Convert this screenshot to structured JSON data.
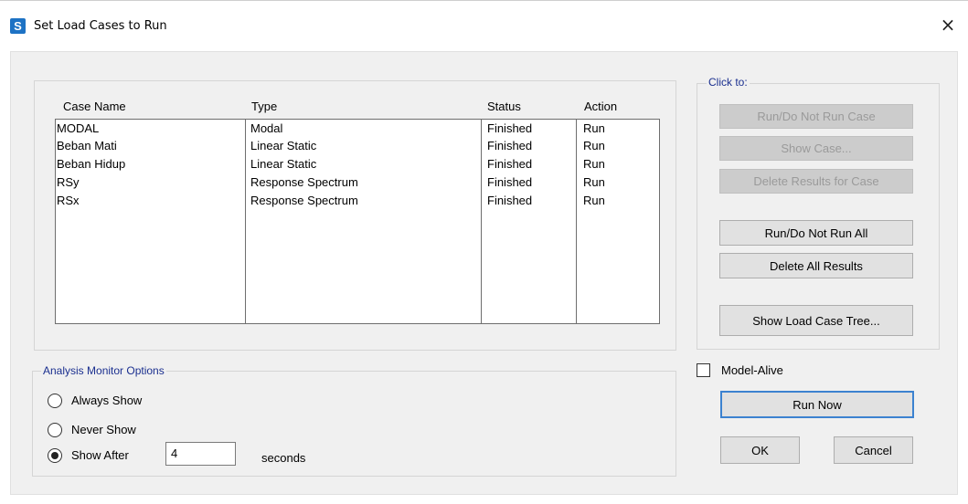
{
  "window": {
    "app_icon_letter": "S",
    "title": "Set Load Cases to Run",
    "close_glyph": "×"
  },
  "table": {
    "headers": [
      "Case Name",
      "Type",
      "Status",
      "Action"
    ],
    "rows": [
      [
        "MODAL",
        "Modal",
        "Finished",
        "Run"
      ],
      [
        "Beban Mati",
        "Linear Static",
        "Finished",
        "Run"
      ],
      [
        "Beban Hidup",
        "Linear Static",
        "Finished",
        "Run"
      ],
      [
        "RSy",
        "Response Spectrum",
        "Finished",
        "Run"
      ],
      [
        "RSx",
        "Response Spectrum",
        "Finished",
        "Run"
      ]
    ]
  },
  "click_to": {
    "title": "Click to:",
    "run_do_not_run_case": "Run/Do Not Run Case",
    "show_case": "Show Case...",
    "delete_results_for_case": "Delete Results for Case",
    "run_do_not_run_all": "Run/Do Not Run All",
    "delete_all_results": "Delete All Results",
    "show_load_case_tree": "Show Load Case Tree..."
  },
  "monitor": {
    "title": "Analysis Monitor Options",
    "always_show": "Always Show",
    "never_show": "Never Show",
    "show_after": "Show After",
    "seconds_value": "4",
    "seconds_label": "seconds",
    "selected": "show_after"
  },
  "model_alive": {
    "label": "Model-Alive",
    "checked": false
  },
  "actions": {
    "run_now": "Run Now",
    "ok": "OK",
    "cancel": "Cancel"
  },
  "colors": {
    "group_title": "#1a2f8f",
    "default_button_border": "#3c82d0",
    "app_icon": "#1d72c4"
  }
}
